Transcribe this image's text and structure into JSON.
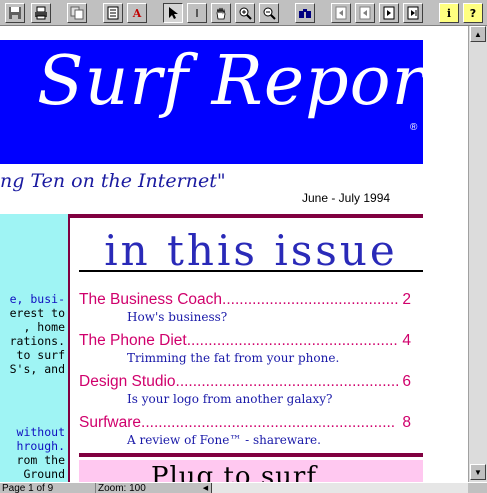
{
  "toolbar": {
    "buttons": [
      {
        "icon": "save-icon"
      },
      {
        "icon": "print-icon"
      },
      {
        "icon": "copy-icon"
      },
      {
        "icon": "text-view-icon"
      },
      {
        "icon": "find-text-icon",
        "glyph": "A"
      },
      {
        "icon": "select-arrow-icon"
      },
      {
        "icon": "text-cursor-icon",
        "glyph": "I"
      },
      {
        "icon": "hand-icon"
      },
      {
        "icon": "zoom-in-icon"
      },
      {
        "icon": "zoom-out-icon"
      },
      {
        "icon": "binoculars-icon"
      },
      {
        "icon": "first-page-icon"
      },
      {
        "icon": "previous-page-icon"
      },
      {
        "icon": "next-page-icon"
      },
      {
        "icon": "last-page-icon"
      },
      {
        "icon": "info-icon",
        "glyph": "i"
      },
      {
        "icon": "help-icon",
        "glyph": "?"
      }
    ]
  },
  "document": {
    "masthead_title": "Surf Report",
    "registered_mark": "®",
    "tagline": "ng Ten on the Internet\"",
    "date": "June - July 1994",
    "section_heading": "in this issue",
    "sidebar_lines": [
      {
        "text": "e, busi-",
        "color": "blue"
      },
      {
        "text": "erest to",
        "color": "black"
      },
      {
        "text": ", home",
        "color": "black"
      },
      {
        "text": "rations.",
        "color": "black"
      },
      {
        "text": "to surf",
        "color": "black"
      },
      {
        "text": "S's, and",
        "color": "black"
      },
      {
        "text": "without",
        "color": "blue"
      },
      {
        "text": "hrough.",
        "color": "blue"
      },
      {
        "text": "rom the",
        "color": "black"
      },
      {
        "text": "Ground",
        "color": "black"
      }
    ],
    "toc": [
      {
        "title": "The Business Coach",
        "page": "2",
        "subtitle": "How's business?"
      },
      {
        "title": "The Phone Diet",
        "page": "4",
        "subtitle": "Trimming the fat from your phone."
      },
      {
        "title": "Design Studio",
        "page": "6",
        "subtitle": "Is your logo from another galaxy?"
      },
      {
        "title": "Surfware",
        "page": "8",
        "subtitle": "A review of Fone™ - shareware."
      }
    ],
    "plug_text": "Plug to surf"
  },
  "status": {
    "page": "Page 1 of 9",
    "zoom": "Zoom: 100"
  },
  "colors": {
    "masthead": "#0000ff",
    "toc_title": "#d0006c",
    "sidebar": "#9ff4f4",
    "rule": "#800040"
  }
}
